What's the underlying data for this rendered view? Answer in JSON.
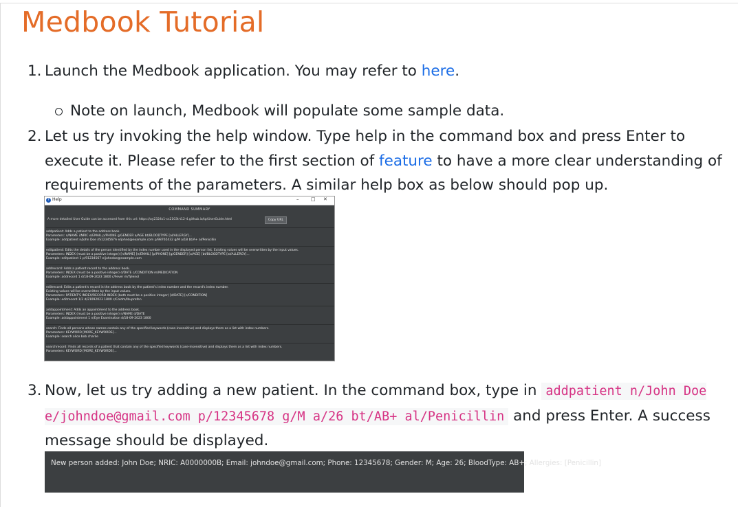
{
  "title": "Medbook Tutorial",
  "steps": [
    {
      "number": "1.",
      "text_before": "Launch the Medbook application. You may refer to ",
      "link": "here",
      "text_after": ".",
      "note": "Note on launch, Medbook will populate some sample data."
    },
    {
      "number": "2.",
      "text_before": "Let us try invoking the help window. Type help in the command box and press Enter to execute it. Please refer to the first section of ",
      "link": "feature",
      "text_after": " to have a more clear understanding of requirements of the parameters. A similar help box as below should pop up."
    },
    {
      "number": "3.",
      "text_before": "Now, let us try adding a new patient. In the command box, type in ",
      "code": "addpatient n/John Doe e/johndoe@gmail.com p/12345678 g/M a/26 bt/AB+ al/Penicillin",
      "text_after": " and press Enter. A success message should be displayed."
    }
  ],
  "help_window": {
    "title": "Help",
    "minimize": "–",
    "maximize": "□",
    "close": "✕",
    "heading": "COMMAND SUMMARY",
    "user_guide_text": "A more detailed User Guide can be accessed from this url: https://ay2324s1-cs2103t-t12-4.github.io/tp/UserGuide.html",
    "copy_button": "Copy URL",
    "commands": [
      [
        "addpatient: Adds a patient to the address book.",
        "Parameters: n/NAME i/NRIC e/EMAIL p/PHONE g/GENDER a/AGE bt/BLOODTYPE [al/ALLERGY]...",
        "Example: addpatient n/John Doe i/S1234567A e/johnd@example.com p/98765432 g/M a/18 bt/A+ al/Penicillin"
      ],
      [
        "editpatient: Edits the details of the person identified by the index number used in the displayed person list. Existing values will be overwritten by the input values.",
        "Parameters: INDEX (must be a positive integer) [n/NAME] [e/EMAIL] [p/PHONE] [g/GENDER] [a/AGE] [bt/BLOODTYPE [al/ALLERGY]...",
        "Example: editpatient 1 p/91234567 e/johndoe@example.com"
      ],
      [
        "addrecord: Adds a patient record to the address book.",
        "Parameters: INDEX (must be a positive integer) d/DATE c/CONDITION m/MEDICATION",
        "Example: addrecord 1 d/18-09-2023 1800 c/Fever m/Tylenol"
      ],
      [
        "editrecord: Edits a patient's record in the address book by the patient's index number and the record's index number.",
        "Existing values will be overwritten by the input values.",
        "Parameters: PATIENT'S INDEX/RECORD INDEX (both must be a positive integer) [d/DATE] [c/CONDITION]",
        "Example: editrecord 1/2 d/21092023 1800 c/Coldm/Ibuprofen"
      ],
      [
        "addappointment: Adds an appointment to the address book.",
        "Parameters: INDEX (must be a positive integer) n/NAME d/DATE",
        "Example: addappointment 1 n/Eye Examination d/18-09-2023 1800"
      ],
      [
        "search: Finds all persons whose names contain any of the specified keywords (case-insensitive) and displays them as a list with index numbers.",
        "Parameters: KEYWORD [MORE_KEYWORDS]...",
        "Example: search alice bob charlie"
      ],
      [
        "searchrecord: Finds all records of a patient that contain any of the specified keywords (case-insensitive) and displays them as a list with index numbers.",
        "Parameters: KEYWORD [MORE_KEYWORDS]..."
      ]
    ]
  },
  "success_message": "New person added: John Doe; NRIC: A0000000B; Email: johndoe@gmail.com; Phone: 12345678; Gender: M; Age: 26; BloodType: AB+; Allergies: [Penicillin]",
  "colors": {
    "title": "#e46c28",
    "link": "#1a6ce6",
    "code_text": "#d63384",
    "dark_panel": "#3c3f41"
  }
}
